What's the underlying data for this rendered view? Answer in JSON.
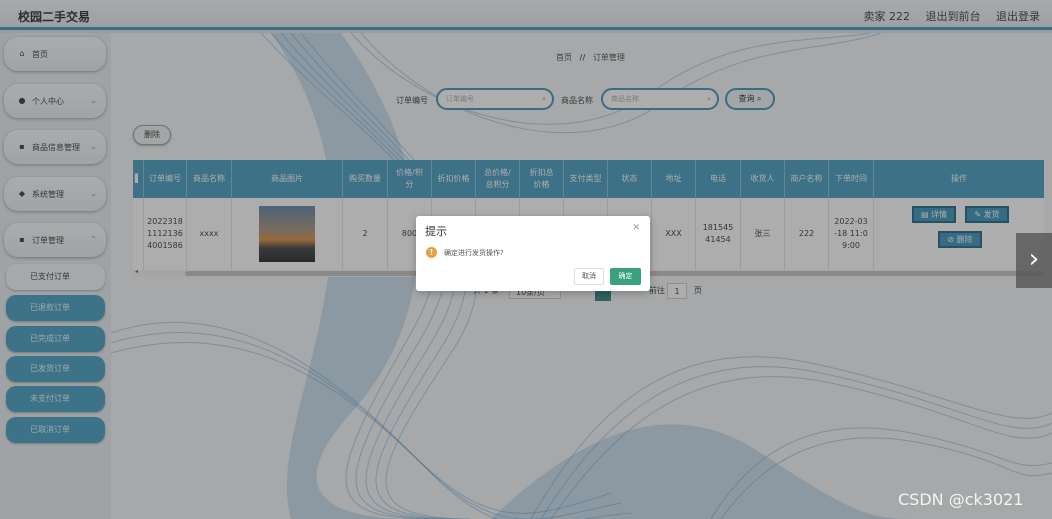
{
  "app": {
    "title": "校园二手交易"
  },
  "topnav": {
    "user": "卖家 222",
    "back_front": "退出到前台",
    "logout": "退出登录"
  },
  "sidebar": {
    "items": [
      {
        "label": "首页",
        "icon": "home-icon"
      },
      {
        "label": "个人中心",
        "icon": "user-icon"
      },
      {
        "label": "商品信息管理",
        "icon": "grid-icon"
      },
      {
        "label": "系统管理",
        "icon": "location-icon"
      },
      {
        "label": "订单管理",
        "icon": "grid-icon"
      }
    ],
    "sub_items": [
      "已支付订单",
      "已退款订单",
      "已完成订单",
      "已发货订单",
      "未支付订单",
      "已取消订单"
    ]
  },
  "breadcrumb": {
    "home": "首页",
    "sep": "//",
    "current": "订单管理"
  },
  "search": {
    "order_label": "订单编号",
    "order_placeholder": "订单编号",
    "product_label": "商品名称",
    "product_placeholder": "商品名称",
    "query_label": "查询"
  },
  "toolbar": {
    "delete_label": "删除"
  },
  "table": {
    "headers": [
      "订单编号",
      "商品名称",
      "商品图片",
      "购买数量",
      "价格/积分",
      "折扣价格",
      "总价格/总积分",
      "折扣总价格",
      "支付类型",
      "状态",
      "地址",
      "电话",
      "收货人",
      "商户名称",
      "下单时间",
      "操作"
    ],
    "row": {
      "order_no": "20223181112136 4001586",
      "product": "xxxx",
      "quantity": "2",
      "price": "800",
      "discount_price": "800",
      "total": "1600",
      "discount_total": "1600",
      "pay_type": "现金",
      "status": "已支付",
      "address": "XXX",
      "phone": "18154541454",
      "receiver": "张三",
      "merchant": "222",
      "time": "2022-03 -18 11:0 9:00",
      "detail_label": "详情",
      "ship_label": "发货",
      "delete_label": "删除"
    }
  },
  "pagination": {
    "total_text": "共 1 条",
    "page_size": "10条/页",
    "current_page": "1",
    "goto_label": "前往",
    "goto_value": "1",
    "page_unit": "页"
  },
  "modal": {
    "title": "提示",
    "message": "确定进行发货操作?",
    "cancel": "取消",
    "ok": "确定"
  },
  "watermark": "CSDN @ck3021"
}
